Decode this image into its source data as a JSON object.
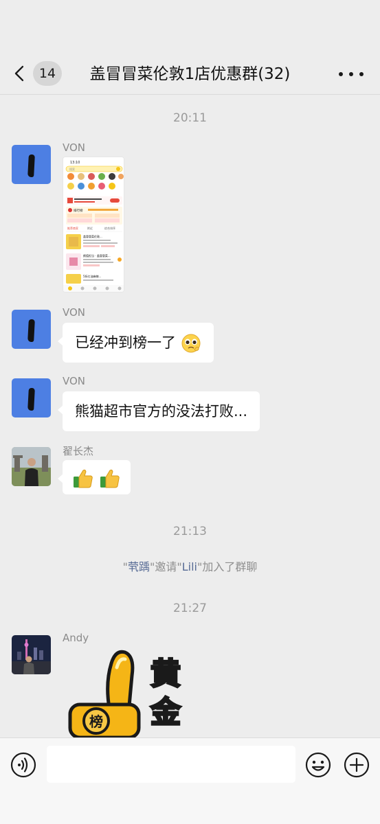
{
  "header": {
    "unread_count": "14",
    "title": "盖冒冒菜伦敦1店优惠群(32)"
  },
  "messages": [
    {
      "kind": "time",
      "text": "20:11"
    },
    {
      "kind": "image",
      "sender": "VON",
      "avatar": "blue-avatar-with-black-mark",
      "image": {
        "status_time": "13:10",
        "search_placeholder": "搜索",
        "category_labels": [
          "美食",
          "甜品饮品",
          "超市便利",
          "水果",
          "买菜",
          "外卖"
        ],
        "rows": [
          "排行榜",
          "特色美食",
          "附近好店"
        ],
        "tabs": [
          "推荐商家",
          "附近",
          "综合排序"
        ],
        "store_names": [
          "盖冒冒菜伦敦...",
          "颜值担当 · 盖冒冒菜...",
          "5折红油麻辣..."
        ]
      }
    },
    {
      "kind": "text",
      "sender": "VON",
      "avatar": "blue-avatar-with-black-mark",
      "text": "已经冲到榜一了",
      "emoji": "pleading-face-emoji"
    },
    {
      "kind": "text",
      "sender": "VON",
      "avatar": "blue-avatar-with-black-mark",
      "text": "熊猫超市官方的没法打败..."
    },
    {
      "kind": "emoji",
      "sender": "翟长杰",
      "avatar": "photo-man-at-stonehenge",
      "emojis": [
        "thumbs-up-emoji",
        "thumbs-up-emoji"
      ]
    },
    {
      "kind": "time",
      "text": "21:13"
    },
    {
      "kind": "system",
      "quote_open": "\"",
      "inviter": "茕踽",
      "middle": "\"邀请\"",
      "invitee": "Lili",
      "tail": "\"加入了群聊"
    },
    {
      "kind": "time",
      "text": "21:27"
    },
    {
      "kind": "sticker",
      "sender": "Andy",
      "avatar": "photo-city-skyline-night",
      "sticker": {
        "badge_text": "榜",
        "big_text": [
          "黄",
          "金"
        ]
      }
    }
  ],
  "input_bar": {
    "placeholder": "",
    "voice_icon": "voice-icon",
    "emoji_icon": "emoji-icon",
    "plus_icon": "plus-icon"
  },
  "colors": {
    "background": "#ededed",
    "bubble": "#ffffff",
    "nickname_link": "#576b95",
    "sticker_yellow": "#f5b516"
  }
}
